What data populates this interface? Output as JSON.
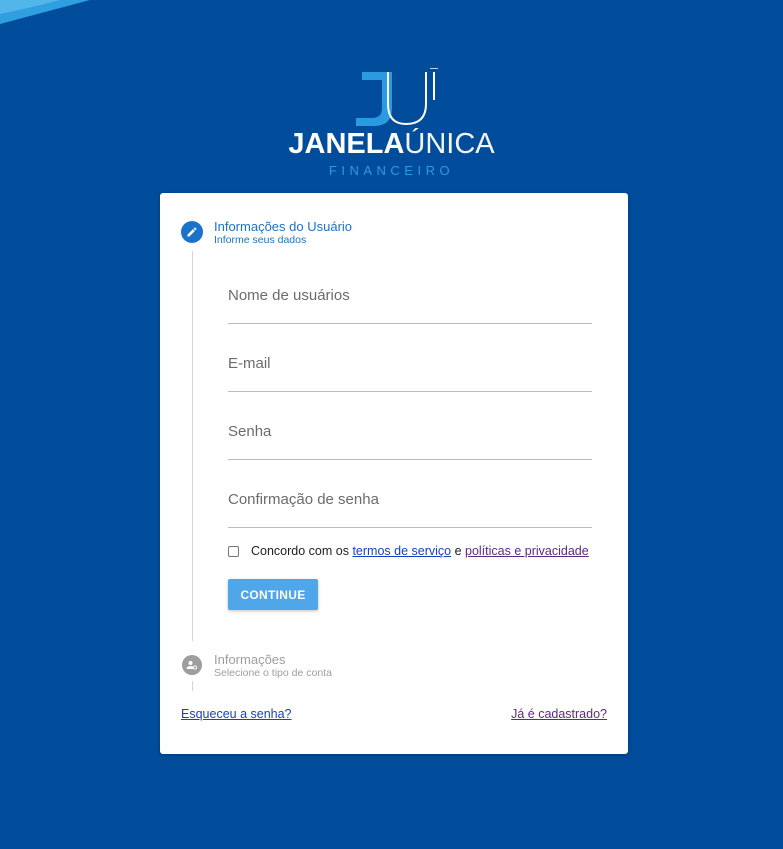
{
  "brand": {
    "logo_letters": "JU",
    "name_bold": "JANELA",
    "name_light": "ÚNICA",
    "subtitle": "FINANCEIRO"
  },
  "steps": [
    {
      "title": "Informações do Usuário",
      "subtitle": "Informe seus dados",
      "icon": "pencil-icon",
      "active": true
    },
    {
      "title": "Informações",
      "subtitle": "Selecione o tipo de conta",
      "icon": "account-settings-icon",
      "active": false
    }
  ],
  "form": {
    "fields": [
      {
        "label": "Nome de usuários",
        "value": ""
      },
      {
        "label": "E-mail",
        "value": ""
      },
      {
        "label": "Senha",
        "value": ""
      },
      {
        "label": "Confirmação de senha",
        "value": ""
      }
    ],
    "terms": {
      "checked": false,
      "prefix": "Concordo com os ",
      "terms_link": "termos de serviço",
      "conjunction": " e ",
      "privacy_link": "políticas e privacidade"
    },
    "continue_label": "CONTINUE"
  },
  "footer": {
    "forgot_password": "Esqueceu a senha?",
    "already_registered": "Já é cadastrado?"
  },
  "colors": {
    "background": "#024c9c",
    "accent": "#1a73c9",
    "button": "#4fa6e8",
    "link": "#1a3fbf",
    "visited_link": "#5b2a86"
  }
}
